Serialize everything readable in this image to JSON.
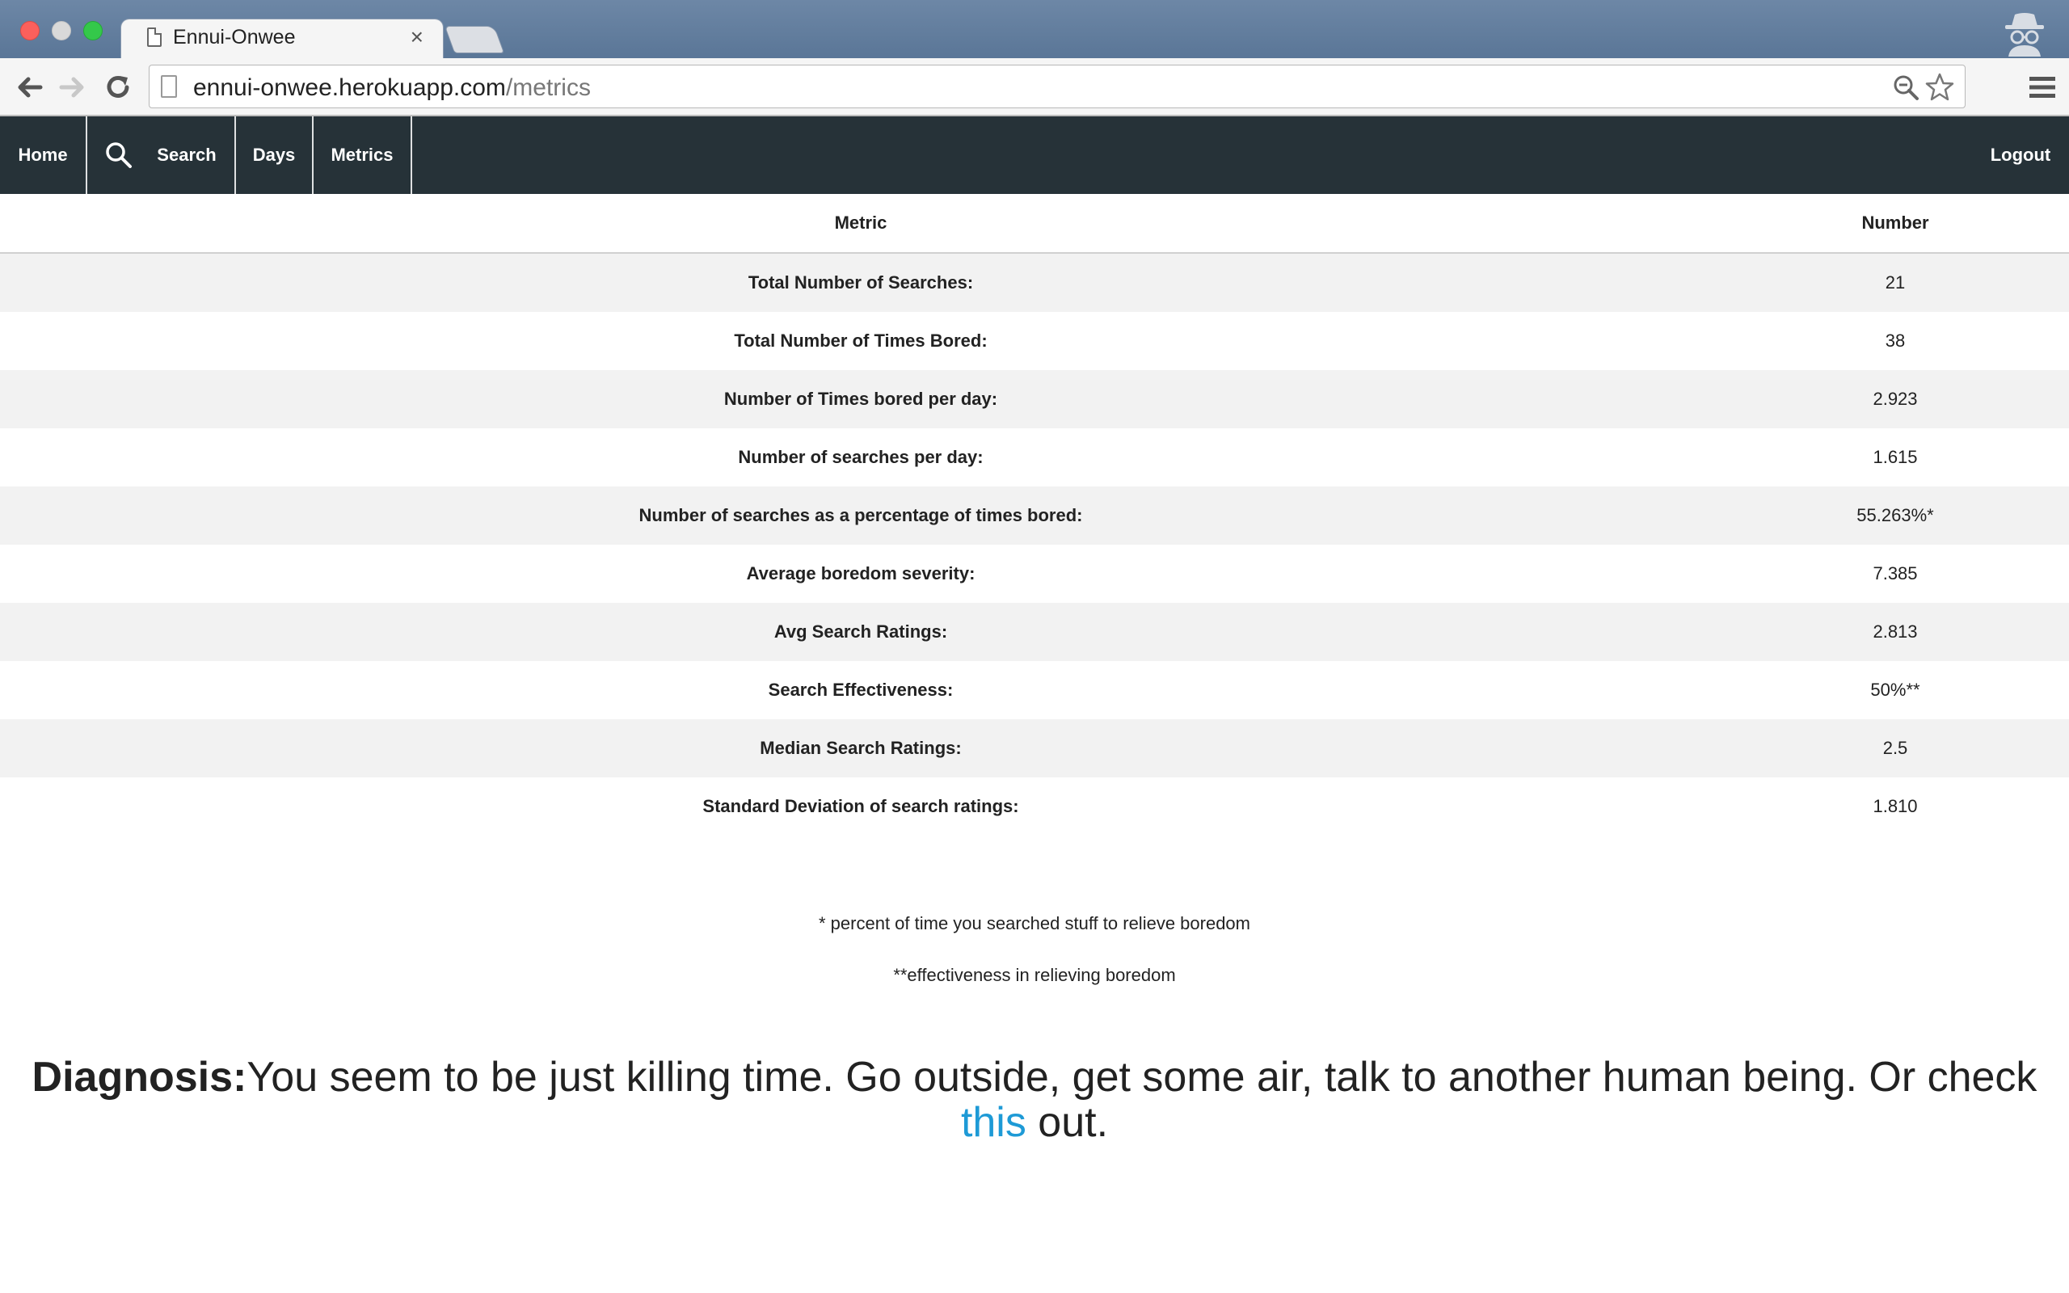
{
  "browser": {
    "tab_title": "Ennui-Onwee",
    "tab_close": "×",
    "url_host": "ennui-onwee.herokuapp.com",
    "url_path": "/metrics"
  },
  "navbar": {
    "home": "Home",
    "search": "Search",
    "days": "Days",
    "metrics": "Metrics",
    "logout": "Logout"
  },
  "table": {
    "headers": {
      "metric": "Metric",
      "number": "Number"
    },
    "rows": [
      {
        "metric": "Total Number of Searches:",
        "number": "21"
      },
      {
        "metric": "Total Number of Times Bored:",
        "number": "38"
      },
      {
        "metric": "Number of Times bored per day:",
        "number": "2.923"
      },
      {
        "metric": "Number of searches per day:",
        "number": "1.615"
      },
      {
        "metric": "Number of searches as a percentage of times bored:",
        "number": "55.263%*"
      },
      {
        "metric": "Average boredom severity:",
        "number": "7.385"
      },
      {
        "metric": "Avg Search Ratings:",
        "number": "2.813"
      },
      {
        "metric": "Search Effectiveness:",
        "number": "50%**"
      },
      {
        "metric": "Median Search Ratings:",
        "number": "2.5"
      },
      {
        "metric": "Standard Deviation of search ratings:",
        "number": "1.810"
      }
    ]
  },
  "footnotes": {
    "one": "* percent of time you searched stuff to relieve boredom",
    "two": "**effectiveness in relieving boredom"
  },
  "diagnosis": {
    "label": "Diagnosis:",
    "text": "You seem to be just killing time. Go outside, get some air, talk to another human being. Or check ",
    "link": "this",
    "tail": " out."
  },
  "colors": {
    "navbar_bg": "#263238",
    "row_stripe": "#f2f2f2",
    "link": "#1e9ad6"
  }
}
